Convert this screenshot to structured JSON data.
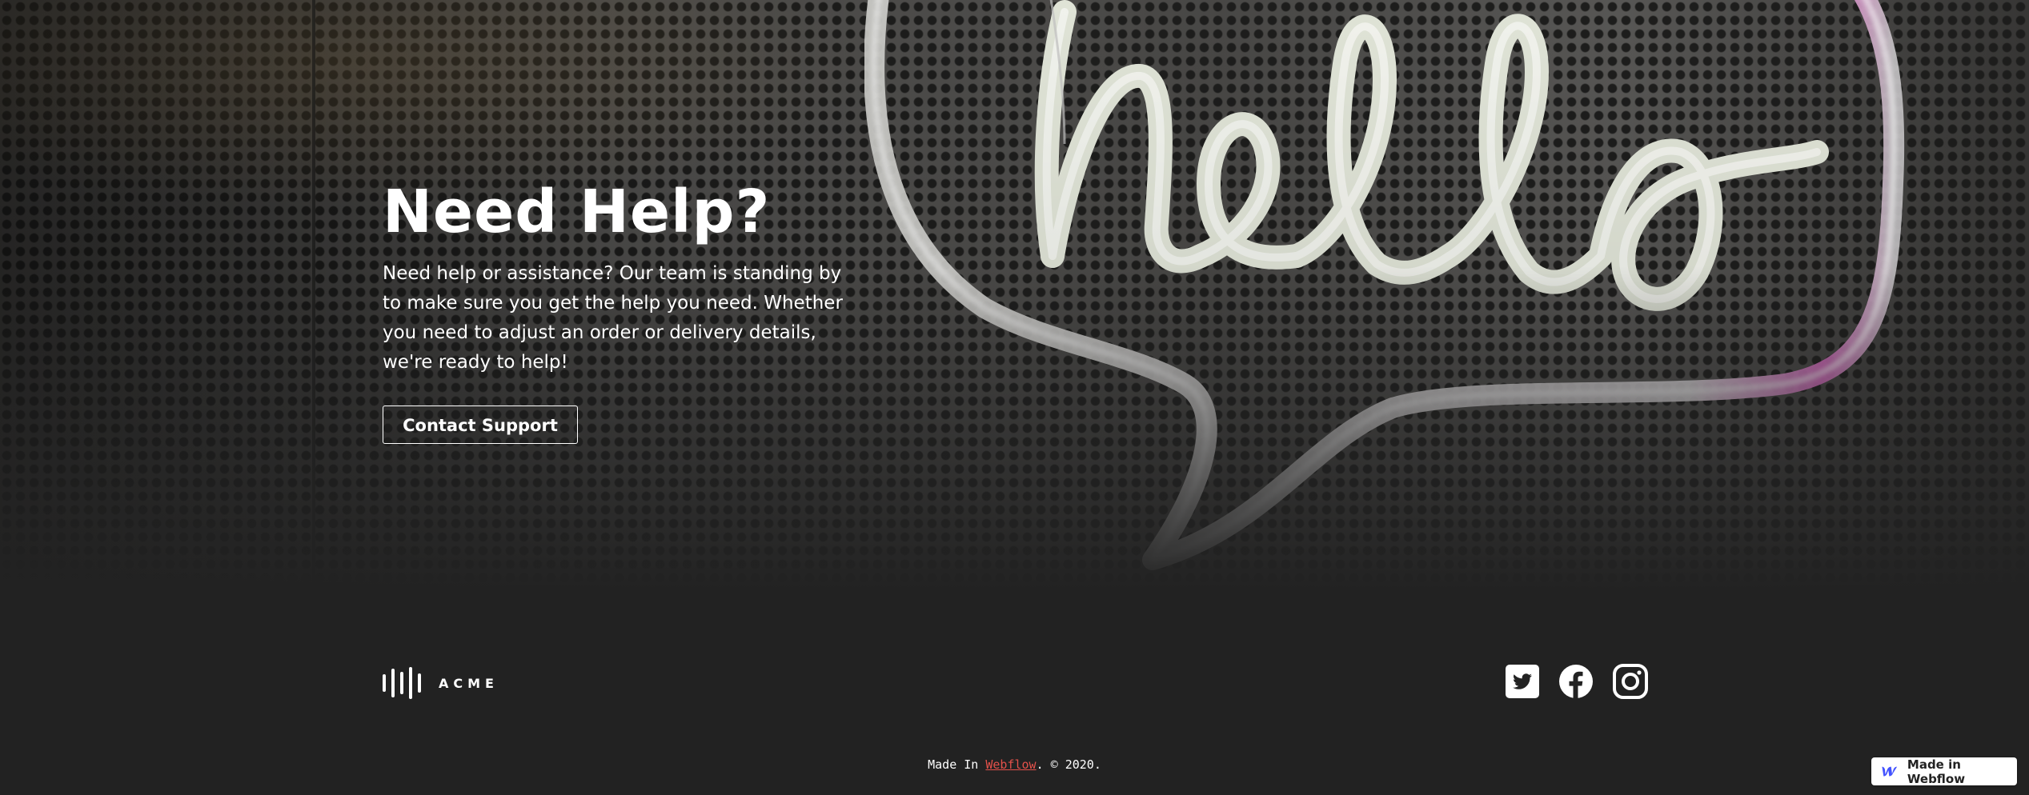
{
  "hero": {
    "title": "Need Help?",
    "description": "Need help or assistance? Our team is standing by to make sure you get the help you need. Whether you need to adjust an order or delivery details, we're ready to help!",
    "cta_label": "Contact Support",
    "background_sign_text": "hello"
  },
  "footer": {
    "brand_name": "ACME",
    "brand_icon": "soundwave-logo-icon",
    "social": [
      {
        "name": "twitter",
        "icon": "twitter-icon"
      },
      {
        "name": "facebook",
        "icon": "facebook-icon"
      },
      {
        "name": "instagram",
        "icon": "instagram-icon"
      }
    ],
    "copyright_prefix": "Made In ",
    "copyright_link": "Webflow",
    "copyright_suffix": ". © 2020."
  },
  "badge": {
    "label": "Made in Webflow",
    "icon": "webflow-logo-icon"
  },
  "colors": {
    "footer_bg": "#222222",
    "link": "#e3514a",
    "webflow_blue": "#4353ff"
  }
}
